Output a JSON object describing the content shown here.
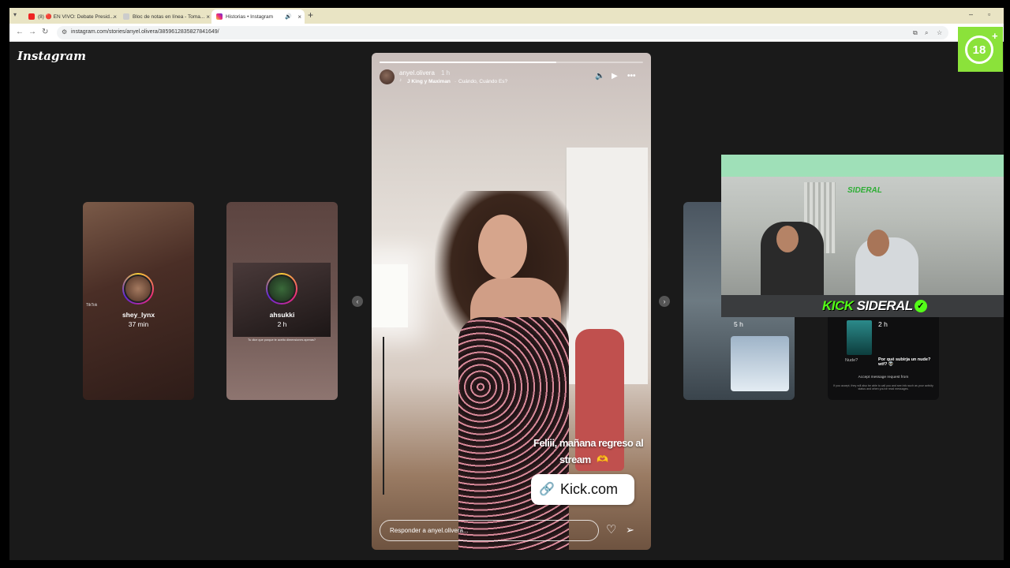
{
  "browser": {
    "tabs": [
      {
        "label": "(8) 🔴 EN VIVO: Debate Presid...",
        "active": false
      },
      {
        "label": "Bloc de notas en línea - Toma...",
        "active": false
      },
      {
        "label": "Historias • Instagram",
        "active": true
      }
    ],
    "new_tab": "+",
    "url": "instagram.com/stories/anyel.olivera/3859612835827841649/"
  },
  "instagram": {
    "logo": "Instagram",
    "side_stories": [
      {
        "username": "shey_lynx",
        "time": "37 min"
      },
      {
        "username": "ahsukki",
        "time": "2 h"
      }
    ],
    "card1_watermark": "TikTok",
    "card2_caption": "Tu dice que porque te aceito dimensiones apenas?",
    "story": {
      "progress": 0.67,
      "username": "anyel.olivera",
      "time": "1 h",
      "song_artist": "J King y Maximan",
      "song_separator": "·",
      "song_title": "Cuándo, Cuándo Es?",
      "caption_line1": "Feliii, mañana regreso al",
      "caption_line2": "stream",
      "caption_emoji": "🫶",
      "link_sticker": "Kick.com",
      "reply_placeholder": "Responder a anyel.olivera..."
    },
    "right_stories": [
      {
        "time": "5 h"
      },
      {
        "time": "2 h",
        "chip": "Nude?",
        "question": "Por qué subirja un nude? wtf? 👽",
        "accept_title": "Accept message request from",
        "accept_body": "If you accept, they will also be able to call you and see info such as your activity status and when you've read messages."
      }
    ]
  },
  "overlay": {
    "channel_prefix": "KICK",
    "channel_name": "SIDERAL",
    "cam_logo": "SIDERAL",
    "age_rating": "18",
    "age_plus": "+"
  },
  "colors": {
    "kick_green": "#53fc18",
    "age_badge": "#8be23a",
    "page_bg": "#1a1a1a"
  }
}
